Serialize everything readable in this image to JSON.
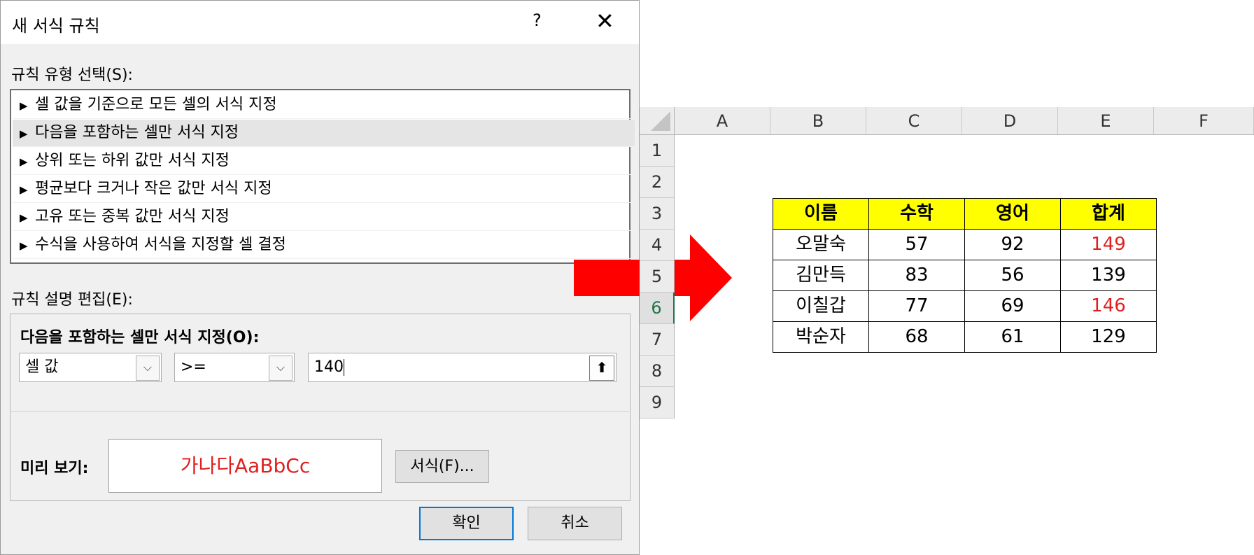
{
  "dialog": {
    "title": "새 서식 규칙",
    "help": "?",
    "close": "✕",
    "rule_type_label": "규칙 유형 선택(S):",
    "rule_types": [
      "셀 값을 기준으로 모든 셀의 서식 지정",
      "다음을 포함하는 셀만 서식 지정",
      "상위 또는 하위 값만 서식 지정",
      "평균보다 크거나 작은 값만 서식 지정",
      "고유 또는 중복 값만 서식 지정",
      "수식을 사용하여 서식을 지정할 셀 결정"
    ],
    "selected_rule_index": 1,
    "edit_label": "규칙 설명 편집(E):",
    "edit_title": "다음을 포함하는 셀만 서식 지정(O):",
    "condition_type": "셀 값",
    "operator": ">=",
    "value": "140",
    "preview_label": "미리 보기:",
    "preview_text": "가나다AaBbCc",
    "preview_color": "#e02020",
    "format_button": "서식(F)...",
    "ok_button": "확인",
    "cancel_button": "취소"
  },
  "arrow_color": "#ff0000",
  "sheet": {
    "columns": [
      "A",
      "B",
      "C",
      "D",
      "E",
      "F"
    ],
    "rows": [
      "1",
      "2",
      "3",
      "4",
      "5",
      "6",
      "7",
      "8",
      "9"
    ],
    "active_row": "6",
    "table_header": [
      "이름",
      "수학",
      "영어",
      "합계"
    ],
    "table_rows": [
      {
        "name": "오말숙",
        "math": "57",
        "english": "92",
        "total": "149",
        "highlight": true
      },
      {
        "name": "김만득",
        "math": "83",
        "english": "56",
        "total": "139",
        "highlight": false
      },
      {
        "name": "이칠갑",
        "math": "77",
        "english": "69",
        "total": "146",
        "highlight": true
      },
      {
        "name": "박순자",
        "math": "68",
        "english": "61",
        "total": "129",
        "highlight": false
      }
    ],
    "header_fill": "#ffff00",
    "highlight_color": "#e02020"
  }
}
